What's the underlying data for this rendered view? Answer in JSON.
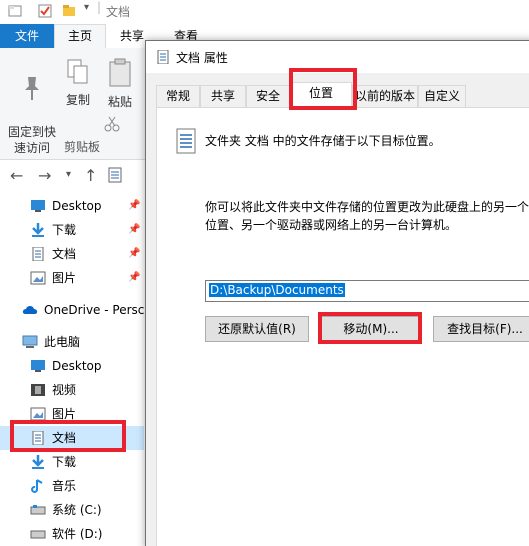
{
  "explorer": {
    "window_title": "文档",
    "ribbon_tabs": {
      "file": "文件",
      "home": "主页",
      "share": "共享",
      "view": "查看"
    },
    "ribbon": {
      "pin_label": "固定到快\n速访问",
      "copy_label": "复制",
      "paste_label": "粘贴",
      "group_label": "剪贴板"
    },
    "sidebar": {
      "items": [
        {
          "label": "Desktop",
          "icon": "desktop-icon"
        },
        {
          "label": "下载",
          "icon": "download-icon"
        },
        {
          "label": "文档",
          "icon": "document-icon"
        },
        {
          "label": "图片",
          "icon": "pictures-icon"
        },
        {
          "label": "OneDrive - Persc",
          "icon": "onedrive-icon"
        },
        {
          "label": "此电脑",
          "icon": "this-pc-icon"
        },
        {
          "label": "Desktop",
          "icon": "desktop-icon"
        },
        {
          "label": "视频",
          "icon": "videos-icon"
        },
        {
          "label": "图片",
          "icon": "pictures-icon"
        },
        {
          "label": "文档",
          "icon": "document-icon"
        },
        {
          "label": "下载",
          "icon": "download-icon"
        },
        {
          "label": "音乐",
          "icon": "music-icon"
        },
        {
          "label": "系统 (C:)",
          "icon": "drive-icon"
        },
        {
          "label": "软件 (D:)",
          "icon": "drive-icon"
        }
      ]
    }
  },
  "dialog": {
    "title": "文档 属性",
    "tabs": [
      "常规",
      "共享",
      "安全",
      "位置",
      "以前的版本",
      "自定义"
    ],
    "active_tab": "位置",
    "description": "文件夹 文档 中的文件存储于以下目标位置。",
    "info": "你可以将此文件夹中文件存储的位置更改为此硬盘上的另一个\n位置、另一个驱动器或网络上的另一台计算机。",
    "path_value": "D:\\Backup\\Documents",
    "buttons": {
      "restore": "还原默认值(R)",
      "move": "移动(M)...",
      "find": "查找目标(F)..."
    }
  },
  "colors": {
    "accent": "#1979ca",
    "highlight": "#e8232f",
    "selection": "#cce8ff"
  }
}
